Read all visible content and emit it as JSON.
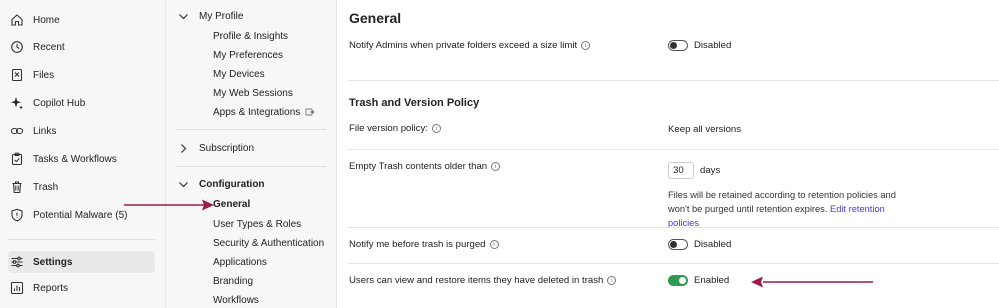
{
  "nav": {
    "items": [
      {
        "label": "Home",
        "icon": "home-icon"
      },
      {
        "label": "Recent",
        "icon": "clock-icon"
      },
      {
        "label": "Files",
        "icon": "files-icon"
      },
      {
        "label": "Copilot Hub",
        "icon": "sparkle-icon"
      },
      {
        "label": "Links",
        "icon": "link-icon"
      },
      {
        "label": "Tasks & Workflows",
        "icon": "clipboard-check-icon"
      },
      {
        "label": "Trash",
        "icon": "trash-icon"
      },
      {
        "label": "Potential Malware (5)",
        "icon": "shield-alert-icon"
      },
      {
        "label": "Settings",
        "icon": "sliders-icon",
        "active": true
      },
      {
        "label": "Reports",
        "icon": "chart-icon"
      }
    ]
  },
  "settings_nav": {
    "my_profile": {
      "label": "My Profile",
      "items": [
        "Profile & Insights",
        "My Preferences",
        "My Devices",
        "My Web Sessions",
        "Apps & Integrations"
      ]
    },
    "subscription": {
      "label": "Subscription"
    },
    "configuration": {
      "label": "Configuration",
      "items": [
        "General",
        "User Types & Roles",
        "Security & Authentication",
        "Applications",
        "Branding",
        "Workflows"
      ],
      "active": "General"
    }
  },
  "main": {
    "title": "General",
    "private_folders": {
      "label": "Notify Admins when private folders exceed a size limit",
      "value": "Disabled",
      "enabled": false
    },
    "trash_section": {
      "title": "Trash and Version Policy",
      "file_version": {
        "label": "File version policy:",
        "value": "Keep all versions"
      },
      "empty_trash": {
        "label": "Empty Trash contents older than",
        "days_value": "30",
        "days_unit": "days",
        "note": "Files will be retained according to retention policies and won't be purged until retention expires.",
        "link": "Edit retention policies"
      },
      "notify_purge": {
        "label": "Notify me before trash is purged",
        "value": "Disabled",
        "enabled": false
      },
      "restore": {
        "label": "Users can view and restore items they have deleted in trash",
        "value": "Enabled",
        "enabled": true
      }
    }
  },
  "colors": {
    "arrow": "#9c1c46",
    "toggle_on": "#2e9a53",
    "link": "#4a3ad2",
    "sidebar_bg": "#f7f7f7"
  }
}
